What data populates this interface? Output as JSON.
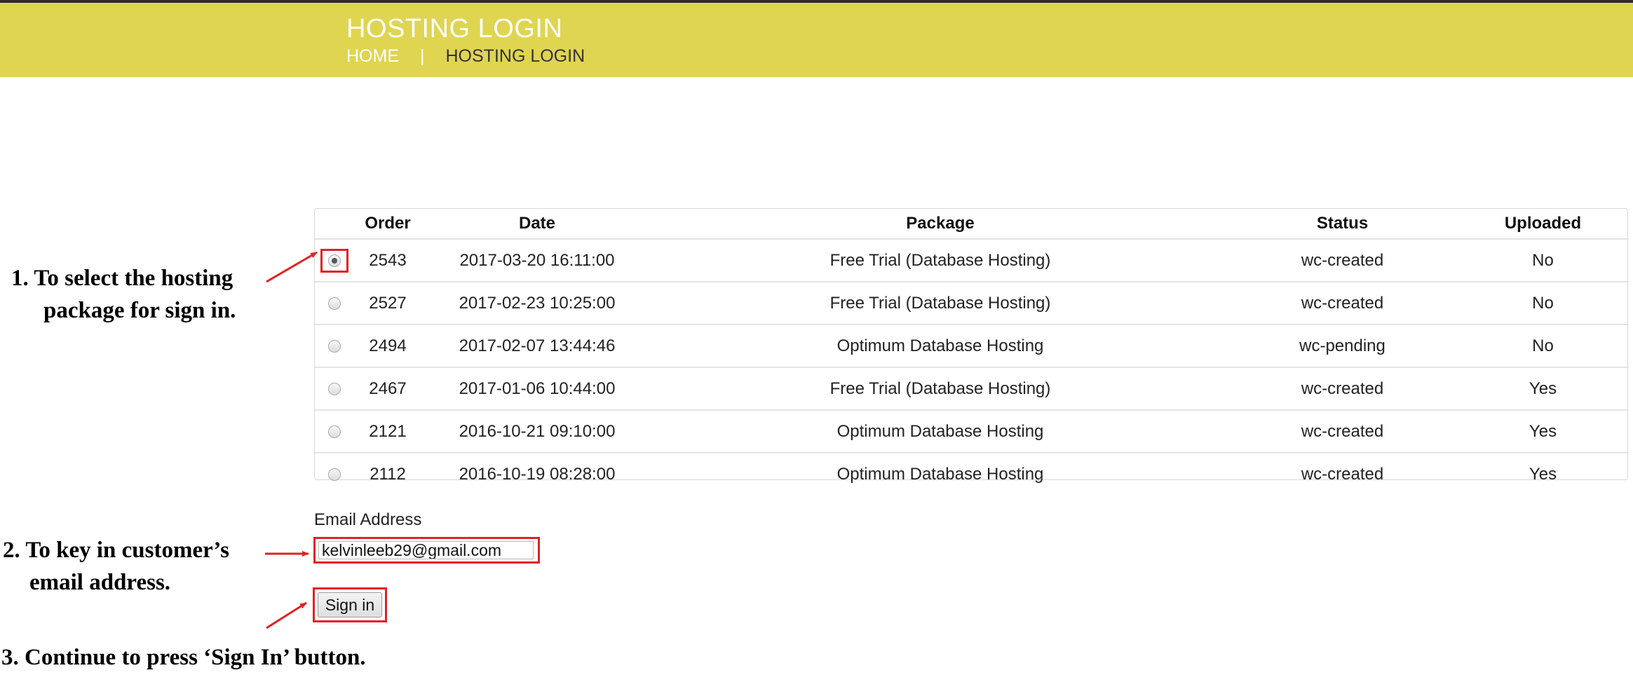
{
  "header": {
    "title": "HOSTING LOGIN",
    "breadcrumb_home": "HOME",
    "breadcrumb_separator": "|",
    "breadcrumb_current": "HOSTING LOGIN"
  },
  "orders_table": {
    "columns": [
      "Order",
      "Date",
      "Package",
      "Status",
      "Uploaded"
    ],
    "rows": [
      {
        "order": "2543",
        "date": "2017-03-20 16:11:00",
        "package": "Free Trial (Database Hosting)",
        "status": "wc-created",
        "uploaded": "No",
        "selected": true
      },
      {
        "order": "2527",
        "date": "2017-02-23 10:25:00",
        "package": "Free Trial (Database Hosting)",
        "status": "wc-created",
        "uploaded": "No",
        "selected": false
      },
      {
        "order": "2494",
        "date": "2017-02-07 13:44:46",
        "package": "Optimum Database Hosting",
        "status": "wc-pending",
        "uploaded": "No",
        "selected": false
      },
      {
        "order": "2467",
        "date": "2017-01-06 10:44:00",
        "package": "Free Trial (Database Hosting)",
        "status": "wc-created",
        "uploaded": "Yes",
        "selected": false
      },
      {
        "order": "2121",
        "date": "2016-10-21 09:10:00",
        "package": "Optimum Database Hosting",
        "status": "wc-created",
        "uploaded": "Yes",
        "selected": false
      },
      {
        "order": "2112",
        "date": "2016-10-19 08:28:00",
        "package": "Optimum Database Hosting",
        "status": "wc-created",
        "uploaded": "Yes",
        "selected": false
      }
    ]
  },
  "form": {
    "email_label": "Email Address",
    "email_value": "kelvinleeb29@gmail.com",
    "signin_label": "Sign in"
  },
  "annotations": {
    "step1_line1": "1. To select the hosting",
    "step1_line2": "package for sign in.",
    "step2_line1": "2. To key in customer’s",
    "step2_line2": "email address.",
    "step3": "3. Continue to press ‘Sign In’ button."
  },
  "colors": {
    "header_bg": "#dfd551",
    "highlight_red": "#e22222"
  }
}
